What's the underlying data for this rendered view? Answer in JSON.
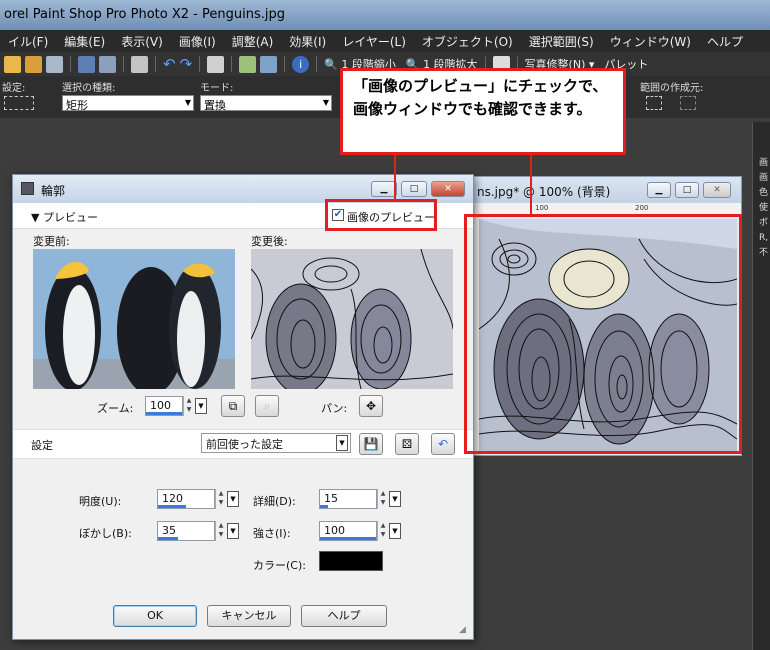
{
  "app": {
    "title": "orel Paint Shop Pro Photo X2 - Penguins.jpg"
  },
  "menu": [
    "イル(F)",
    "編集(E)",
    "表示(V)",
    "画像(I)",
    "調整(A)",
    "効果(I)",
    "レイヤー(L)",
    "オブジェクト(O)",
    "選択範囲(S)",
    "ウィンドウ(W)",
    "ヘルプ"
  ],
  "toolbar": {
    "shrink_label": "1 段階縮小",
    "enlarge_label": "1 段階拡大",
    "photo_fix_label": "写真修整(N) ▾",
    "palette_label": "パレット"
  },
  "options": {
    "setting_label": "設定:",
    "selection_type_label": "選択の種類:",
    "selection_type_value": "矩形",
    "mode_label": "モード:",
    "mode_value": "置換",
    "creation_label": "範囲の作成元:"
  },
  "image_window": {
    "title": "ns.jpg* @ 100% (背景)",
    "ruler_marks": [
      "100",
      "200"
    ]
  },
  "side_panel": {
    "items": [
      "画",
      "画",
      "色",
      "使",
      "ボ",
      "R,",
      "不"
    ]
  },
  "dialog": {
    "title": "輪郭",
    "preview_toggle": "▼ プレビュー",
    "image_preview_label": "画像のプレビュー",
    "image_preview_checked": true,
    "before_label": "変更前:",
    "after_label": "変更後:",
    "zoom_label": "ズーム:",
    "zoom_value": "100",
    "pan_label": "パン:",
    "settings_label": "設定",
    "settings_value": "前回使った設定",
    "brightness_label": "明度(U):",
    "brightness_value": "120",
    "brightness_fraction": 0.5,
    "detail_label": "詳細(D):",
    "detail_value": "15",
    "detail_fraction": 0.15,
    "blur_label": "ぼかし(B):",
    "blur_value": "35",
    "blur_fraction": 0.35,
    "strength_label": "強さ(I):",
    "strength_value": "100",
    "strength_fraction": 1.0,
    "color_label": "カラー(C):",
    "color_value": "#000000",
    "ok_label": "OK",
    "cancel_label": "キャンセル",
    "help_label": "ヘルプ"
  },
  "callout": {
    "text": "「画像のプレビュー」にチェックで、画像ウィンドウでも確認できます。",
    "color": "#e21e1e"
  }
}
